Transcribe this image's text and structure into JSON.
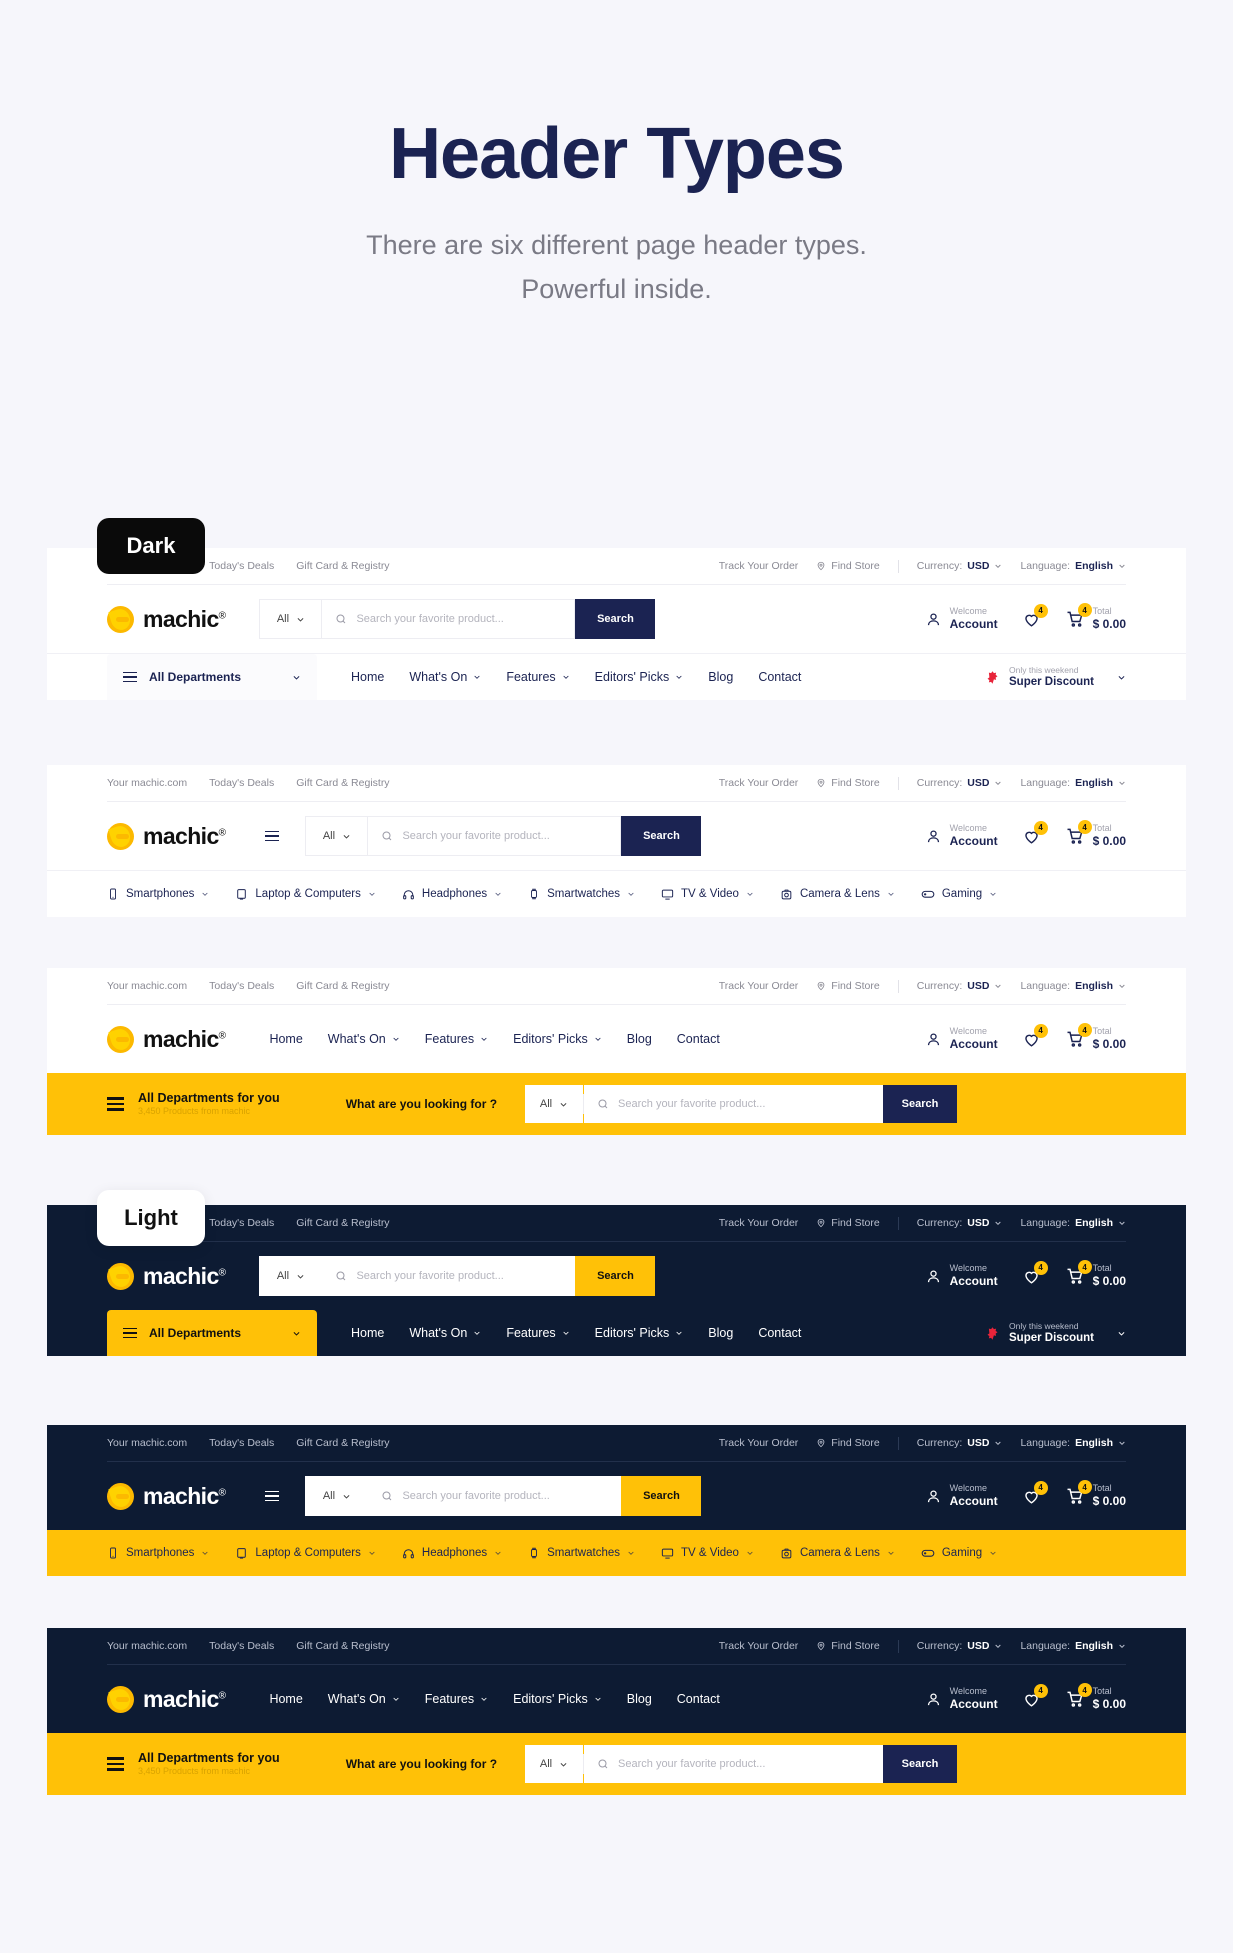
{
  "page": {
    "title": "Header Types",
    "subtitle_line1": "There are six different page header types.",
    "subtitle_line2": "Powerful inside."
  },
  "labels": {
    "dark": "Dark",
    "light": "Light"
  },
  "brand": {
    "name": "machic",
    "registered": "®",
    "accent": "#ffc107",
    "navy": "#1b2352",
    "dark_bg": "#0d1b33"
  },
  "topbar": {
    "links": [
      "Your machic.com",
      "Today's Deals",
      "Gift Card & Registry"
    ],
    "track_order": "Track Your Order",
    "find_store": "Find Store",
    "currency_label": "Currency:",
    "currency_value": "USD",
    "language_label": "Language:",
    "language_value": "English"
  },
  "search": {
    "category": "All",
    "placeholder": "Search your favorite product...",
    "button": "Search"
  },
  "account": {
    "welcome": "Welcome",
    "account": "Account",
    "wishlist_count": "4",
    "cart_count": "4",
    "total_label": "Total",
    "total_value": "$ 0.00"
  },
  "nav": {
    "departments": "All Departments",
    "items": [
      {
        "label": "Home",
        "caret": false
      },
      {
        "label": "What's On",
        "caret": true
      },
      {
        "label": "Features",
        "caret": true
      },
      {
        "label": "Editors' Picks",
        "caret": true
      },
      {
        "label": "Blog",
        "caret": false
      },
      {
        "label": "Contact",
        "caret": false
      }
    ],
    "promo_top": "Only this weekend",
    "promo_bottom": "Super Discount"
  },
  "categories": [
    {
      "label": "Smartphones",
      "icon": "phone-icon"
    },
    {
      "label": "Laptop & Computers",
      "icon": "laptop-icon"
    },
    {
      "label": "Headphones",
      "icon": "headphones-icon"
    },
    {
      "label": "Smartwatches",
      "icon": "watch-icon"
    },
    {
      "label": "TV & Video",
      "icon": "tv-icon"
    },
    {
      "label": "Camera & Lens",
      "icon": "camera-icon"
    },
    {
      "label": "Gaming",
      "icon": "gamepad-icon"
    }
  ],
  "mega": {
    "dept_title": "All Departments for you",
    "dept_sub": "3,450 Products from machic",
    "question": "What are you looking for ?"
  }
}
